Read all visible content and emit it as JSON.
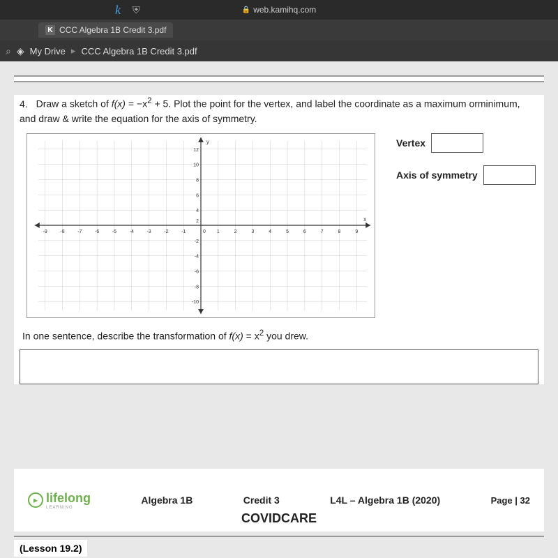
{
  "browser": {
    "url": "web.kamihq.com"
  },
  "tab": {
    "icon_letter": "K",
    "title": "CCC Algebra 1B Credit 3.pdf"
  },
  "breadcrumb": {
    "drive_label": "My Drive",
    "file": "CCC Algebra 1B Credit 3.pdf"
  },
  "question": {
    "number": "4.",
    "text_part1": "Draw a sketch of ",
    "fn": "f(x)",
    "eq": " = −x",
    "exp": "2",
    "text_part2": " + 5. Plot the point for the vertex, and label the coordinate as a maximum orminimum, and draw & write the equation for the axis of symmetry.",
    "vertex_label": "Vertex",
    "axis_label": "Axis of symmetry",
    "transform_prompt_p1": "In one sentence, describe the transformation of ",
    "transform_fn": "f(x)",
    "transform_eq": " = x",
    "transform_exp": "2",
    "transform_prompt_p2": " you drew."
  },
  "chart_data": {
    "type": "scatter",
    "title": "",
    "xlabel": "x",
    "ylabel": "y",
    "xlim": [
      -9,
      9
    ],
    "ylim": [
      -10,
      12
    ],
    "x_ticks": [
      -9,
      -8,
      -7,
      -6,
      -5,
      -4,
      -3,
      -2,
      -1,
      0,
      1,
      2,
      3,
      4,
      5,
      6,
      7,
      8,
      9
    ],
    "y_ticks": [
      -10,
      -8,
      -6,
      -4,
      -2,
      0,
      2,
      4,
      6,
      8,
      10,
      12
    ],
    "series": []
  },
  "footer": {
    "logo": "lifelong",
    "logo_sub": "LEARNING",
    "course": "Algebra 1B",
    "credit": "Credit 3",
    "program": "L4L – Algebra 1B (2020)",
    "page": "Page | 32",
    "watermark": "COVIDCARE"
  },
  "lesson": {
    "ref": "(Lesson 19.2)"
  }
}
